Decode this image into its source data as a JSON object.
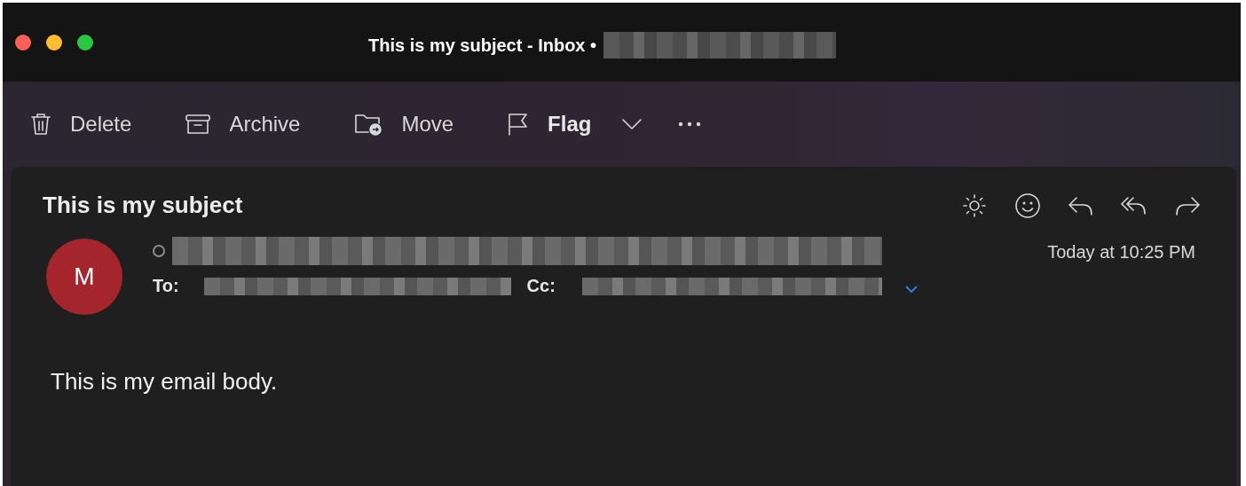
{
  "window": {
    "title": "This is my subject - Inbox •"
  },
  "toolbar": [
    {
      "kind": "delete",
      "label": "Delete"
    },
    {
      "kind": "archive",
      "label": "Archive"
    },
    {
      "kind": "move",
      "label": "Move"
    },
    {
      "kind": "flag",
      "label": "Flag"
    },
    {
      "kind": "caret"
    },
    {
      "kind": "more"
    }
  ],
  "message": {
    "subject": "This is my subject",
    "actions": [
      {
        "kind": "sun"
      },
      {
        "kind": "emoji"
      },
      {
        "kind": "reply"
      },
      {
        "kind": "reply_all"
      },
      {
        "kind": "forward"
      }
    ],
    "avatar": "M",
    "read": true,
    "to_label": "To:",
    "cc_label": "Cc:",
    "date": "Today at 10:25 PM",
    "body": "This is my email body."
  }
}
